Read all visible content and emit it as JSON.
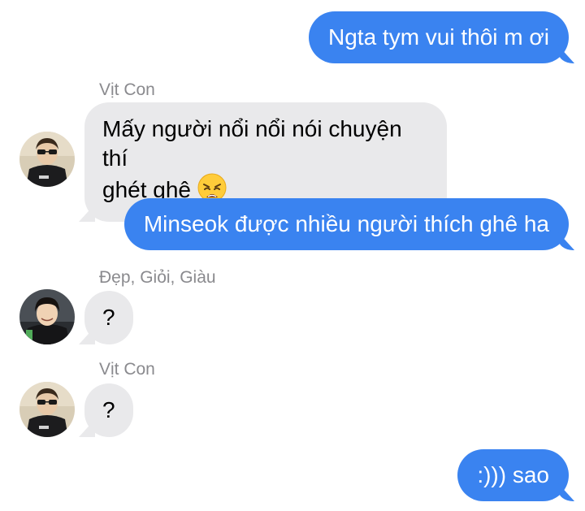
{
  "messages": [
    {
      "from": "me",
      "text": "Ngta tym vui thôi m ơi"
    },
    {
      "from": "other",
      "sender": "Vịt Con",
      "text_line1": "Mấy người nổi nổi nói chuyện thí",
      "text_line2": "ghét ghê",
      "emoji": "weary-face-emoji"
    },
    {
      "from": "me",
      "text": "Minseok được nhiều người thích ghê ha"
    },
    {
      "from": "other",
      "sender": "Đẹp, Giỏi, Giàu",
      "text": "?"
    },
    {
      "from": "other",
      "sender": "Vịt Con",
      "text": "?"
    },
    {
      "from": "me",
      "text": ":))) sao"
    }
  ],
  "colors": {
    "outgoing_bubble": "#3a83f0",
    "incoming_bubble": "#e9e9eb",
    "sender_name": "#8a8a8e"
  }
}
